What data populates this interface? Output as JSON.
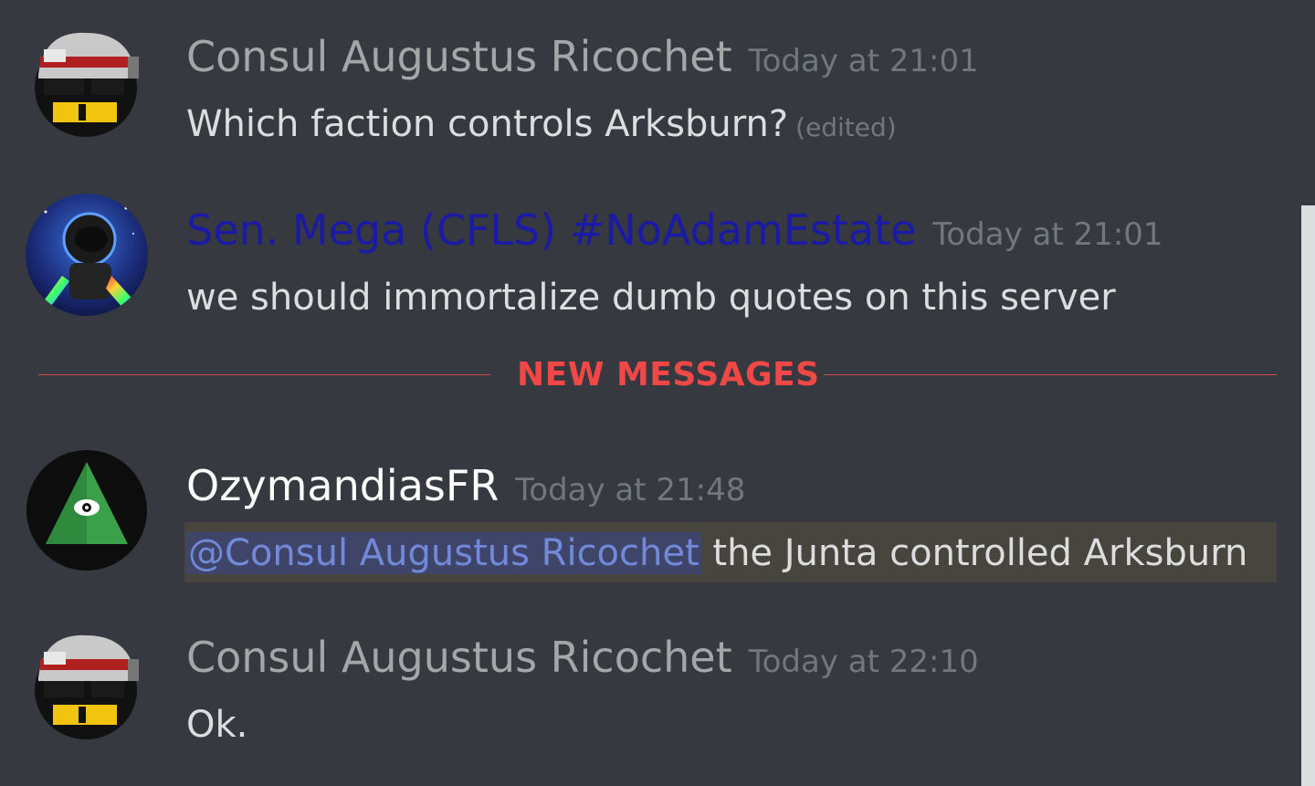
{
  "messages": [
    {
      "username": "Consul Augustus Ricochet",
      "timestamp": "Today at 21:01",
      "content": "Which faction controls Arksburn?",
      "edited": "(edited)",
      "avatar_icon": "soldier-ball-avatar",
      "username_color": "#a5a6a8"
    },
    {
      "username": "Sen. Mega (CFLS) #NoAdamEstate",
      "timestamp": "Today at 21:01",
      "content": "we should immortalize dumb quotes on this server",
      "avatar_icon": "astronaut-avatar",
      "username_color": "#1a1aa6"
    },
    {
      "username": "OzymandiasFR",
      "timestamp": "Today at 21:48",
      "mention": "@Consul Augustus Ricochet",
      "content": "the Junta controlled Arksburn",
      "avatar_icon": "eye-pyramid-avatar",
      "username_color": "#ffffff"
    },
    {
      "username": "Consul Augustus Ricochet",
      "timestamp": "Today at 22:10",
      "content": "Ok.",
      "avatar_icon": "soldier-ball-avatar",
      "username_color": "#a5a6a8"
    }
  ],
  "divider": {
    "label": "NEW MESSAGES",
    "color": "#f04747"
  },
  "colors": {
    "background": "#36393f",
    "mention_text": "#7289da",
    "mention_highlight": "#48443e"
  }
}
